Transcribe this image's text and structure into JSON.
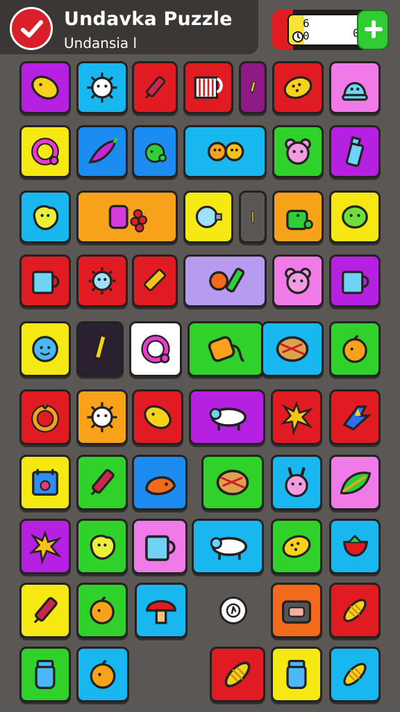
{
  "header": {
    "title": "Undavka Puzzle",
    "subtitle": "Undansia l"
  },
  "counter": {
    "top_value": "6",
    "middle_value": "0",
    "right_value": "0",
    "accent": "#e01b21"
  },
  "colors": {
    "background": "#5b5754",
    "header": "#3a3735",
    "plus_button": "#2fcc34"
  },
  "tiles": [
    {
      "name": "tile-lemon",
      "color": "#b620e0",
      "icon": "lemon"
    },
    {
      "name": "tile-spiky-ball",
      "color": "#19b7f0",
      "icon": "spiky-ball"
    },
    {
      "name": "tile-marker",
      "color": "#e01b21",
      "icon": "marker"
    },
    {
      "name": "tile-cage",
      "color": "#e01b21",
      "icon": "cage"
    },
    {
      "name": "tile-pencil",
      "color": "#8e1a86",
      "icon": "pencil"
    },
    {
      "name": "tile-lemon-dots",
      "color": "#e01b21",
      "icon": "lemon-dots"
    },
    {
      "name": "tile-jelly",
      "color": "#f07be8",
      "icon": "jelly"
    },
    {
      "name": "tile-ring",
      "color": "#f5e813",
      "icon": "ring"
    },
    {
      "name": "tile-pepper",
      "color": "#1d8cf0",
      "icon": "pepper"
    },
    {
      "name": "tile-apple",
      "color": "#1d8cf0",
      "icon": "apple"
    },
    {
      "name": "tile-fox-pair",
      "color": "#19b7f0",
      "icon": "fox-pair"
    },
    {
      "name": "tile-bear",
      "color": "#2fd12a",
      "icon": "bear"
    },
    {
      "name": "tile-bottle",
      "color": "#b620e0",
      "icon": "bottle"
    },
    {
      "name": "tile-blob",
      "color": "#19b7f0",
      "icon": "blob"
    },
    {
      "name": "tile-barrel-berries",
      "color": "#f7a21a",
      "icon": "barrel-berries"
    },
    {
      "name": "tile-bulb",
      "color": "#f5e813",
      "icon": "bulb"
    },
    {
      "name": "tile-stick",
      "color": "#5b5754",
      "icon": "stick"
    },
    {
      "name": "tile-watering-can",
      "color": "#f7a21a",
      "icon": "watering-can"
    },
    {
      "name": "tile-lime",
      "color": "#f5e813",
      "icon": "lime"
    },
    {
      "name": "tile-mug",
      "color": "#e01b21",
      "icon": "mug"
    },
    {
      "name": "tile-sun-face",
      "color": "#e01b21",
      "icon": "sun-face"
    },
    {
      "name": "tile-crayon",
      "color": "#e01b21",
      "icon": "crayon"
    },
    {
      "name": "tile-cat-battery",
      "color": "#b69bf0",
      "icon": "cat-battery"
    },
    {
      "name": "tile-pink-bear",
      "color": "#f07be8",
      "icon": "bear"
    },
    {
      "name": "tile-cup",
      "color": "#b620e0",
      "icon": "mug"
    },
    {
      "name": "tile-smile-ball",
      "color": "#f5e813",
      "icon": "smile-ball"
    },
    {
      "name": "tile-dark-pencil",
      "color": "#2b2030",
      "icon": "pencil"
    },
    {
      "name": "tile-ring-white",
      "color": "#ffffff",
      "icon": "ring"
    },
    {
      "name": "tile-sack",
      "color": "#2fd12a",
      "icon": "sack"
    },
    {
      "name": "tile-nut",
      "color": "#19b7f0",
      "icon": "nut"
    },
    {
      "name": "tile-orange",
      "color": "#2fd12a",
      "icon": "orange"
    },
    {
      "name": "tile-ring-orange",
      "color": "#e01b21",
      "icon": "ring-gold"
    },
    {
      "name": "tile-sun-ball",
      "color": "#f7a21a",
      "icon": "spiky-ball"
    },
    {
      "name": "tile-lemon-red",
      "color": "#e01b21",
      "icon": "lemon"
    },
    {
      "name": "tile-dog",
      "color": "#b620e0",
      "icon": "dog"
    },
    {
      "name": "tile-splat",
      "color": "#e01b21",
      "icon": "splat"
    },
    {
      "name": "tile-bolt",
      "color": "#e01b21",
      "icon": "bolt"
    },
    {
      "name": "tile-calendar",
      "color": "#f5e813",
      "icon": "calendar"
    },
    {
      "name": "tile-purple-marker",
      "color": "#2fd12a",
      "icon": "marker"
    },
    {
      "name": "tile-fox",
      "color": "#1d8cf0",
      "icon": "fox"
    },
    {
      "name": "tile-corn-husk",
      "color": "#2fd12a",
      "icon": "nut"
    },
    {
      "name": "tile-bunny",
      "color": "#19b7f0",
      "icon": "bunny"
    },
    {
      "name": "tile-leaf",
      "color": "#f07be8",
      "icon": "leaf"
    },
    {
      "name": "tile-spark",
      "color": "#b620e0",
      "icon": "splat"
    },
    {
      "name": "tile-yellow-blob",
      "color": "#2fd12a",
      "icon": "blob"
    },
    {
      "name": "tile-pink-cup",
      "color": "#f07be8",
      "icon": "mug"
    },
    {
      "name": "tile-cow",
      "color": "#19b7f0",
      "icon": "dog"
    },
    {
      "name": "tile-lemon-spotted",
      "color": "#2fd12a",
      "icon": "lemon-dots"
    },
    {
      "name": "tile-strawberry",
      "color": "#19b7f0",
      "icon": "strawberry"
    },
    {
      "name": "tile-green-marker",
      "color": "#f5e813",
      "icon": "marker"
    },
    {
      "name": "tile-tomato",
      "color": "#2fd12a",
      "icon": "orange"
    },
    {
      "name": "tile-mushroom",
      "color": "#19b7f0",
      "icon": "mushroom"
    },
    {
      "name": "tile-toaster",
      "color": "#f26a1b",
      "icon": "toaster"
    },
    {
      "name": "tile-corn",
      "color": "#e01b21",
      "icon": "corn"
    },
    {
      "name": "tile-lamp",
      "color": "#2fd12a",
      "icon": "jar"
    },
    {
      "name": "tile-orange-fruit",
      "color": "#19b7f0",
      "icon": "orange"
    },
    {
      "name": "tile-candy",
      "color": "#e01b21",
      "icon": "corn"
    },
    {
      "name": "tile-jar",
      "color": "#f5e813",
      "icon": "jar"
    },
    {
      "name": "tile-bread",
      "color": "#19b7f0",
      "icon": "corn"
    }
  ]
}
